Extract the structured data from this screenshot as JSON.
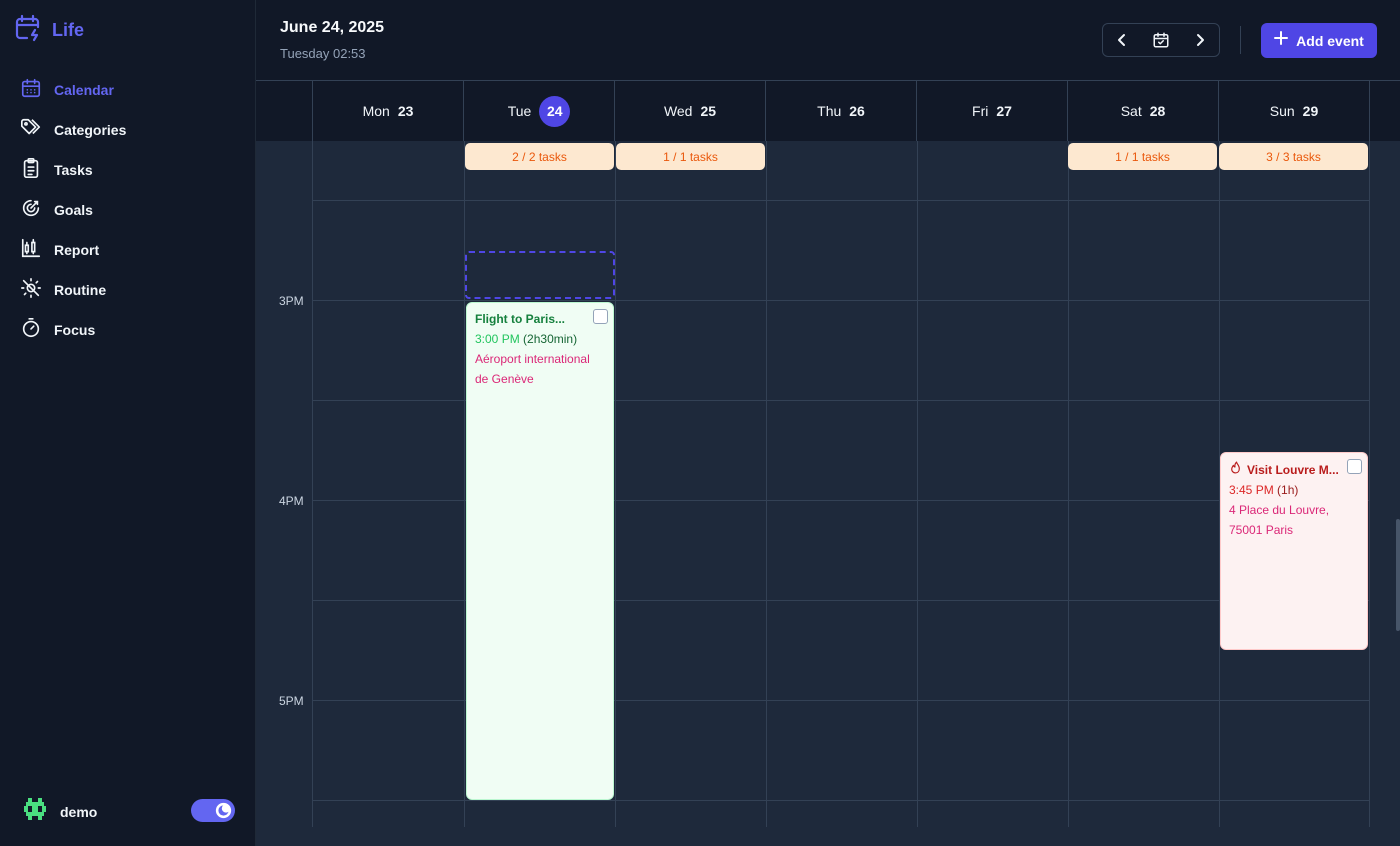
{
  "app": {
    "name": "Life"
  },
  "sidebar": {
    "items": [
      {
        "label": "Calendar",
        "icon": "calendar-icon",
        "active": true
      },
      {
        "label": "Categories",
        "icon": "tags-icon"
      },
      {
        "label": "Tasks",
        "icon": "clipboard-icon"
      },
      {
        "label": "Goals",
        "icon": "target-icon"
      },
      {
        "label": "Report",
        "icon": "chart-icon"
      },
      {
        "label": "Routine",
        "icon": "sun-moon-icon"
      },
      {
        "label": "Focus",
        "icon": "timer-icon"
      }
    ],
    "user": {
      "name": "demo",
      "avatar_icon": "alien-icon"
    },
    "theme_toggle": {
      "state": "dark",
      "icon": "moon-icon"
    }
  },
  "header": {
    "date": "June 24, 2025",
    "subtitle": "Tuesday 02:53",
    "add_button": "Add event"
  },
  "days": [
    {
      "name": "Mon",
      "num": "23"
    },
    {
      "name": "Tue",
      "num": "24",
      "today": true
    },
    {
      "name": "Wed",
      "num": "25"
    },
    {
      "name": "Thu",
      "num": "26"
    },
    {
      "name": "Fri",
      "num": "27"
    },
    {
      "name": "Sat",
      "num": "28"
    },
    {
      "name": "Sun",
      "num": "29"
    }
  ],
  "task_pills": {
    "tue": "2 / 2 tasks",
    "wed": "1 / 1 tasks",
    "sat": "1 / 1 tasks",
    "sun": "3 / 3 tasks"
  },
  "hours": [
    "3PM",
    "4PM",
    "5PM"
  ],
  "events": {
    "flight": {
      "title": "Flight to Paris...",
      "time": "3:00 PM",
      "duration": "(2h30min)",
      "location": "Aéroport international de Genève",
      "color": "#15803d"
    },
    "louvre": {
      "title": "Visit Louvre M...",
      "time": "3:45 PM",
      "duration": "(1h)",
      "location": "4 Place du Louvre, 75001 Paris",
      "color": "#b91c1c",
      "icon": "flame-icon"
    }
  },
  "colors": {
    "accent": "#4f46e5",
    "pill_bg": "#fde8d0",
    "pill_text": "#ea580c"
  }
}
